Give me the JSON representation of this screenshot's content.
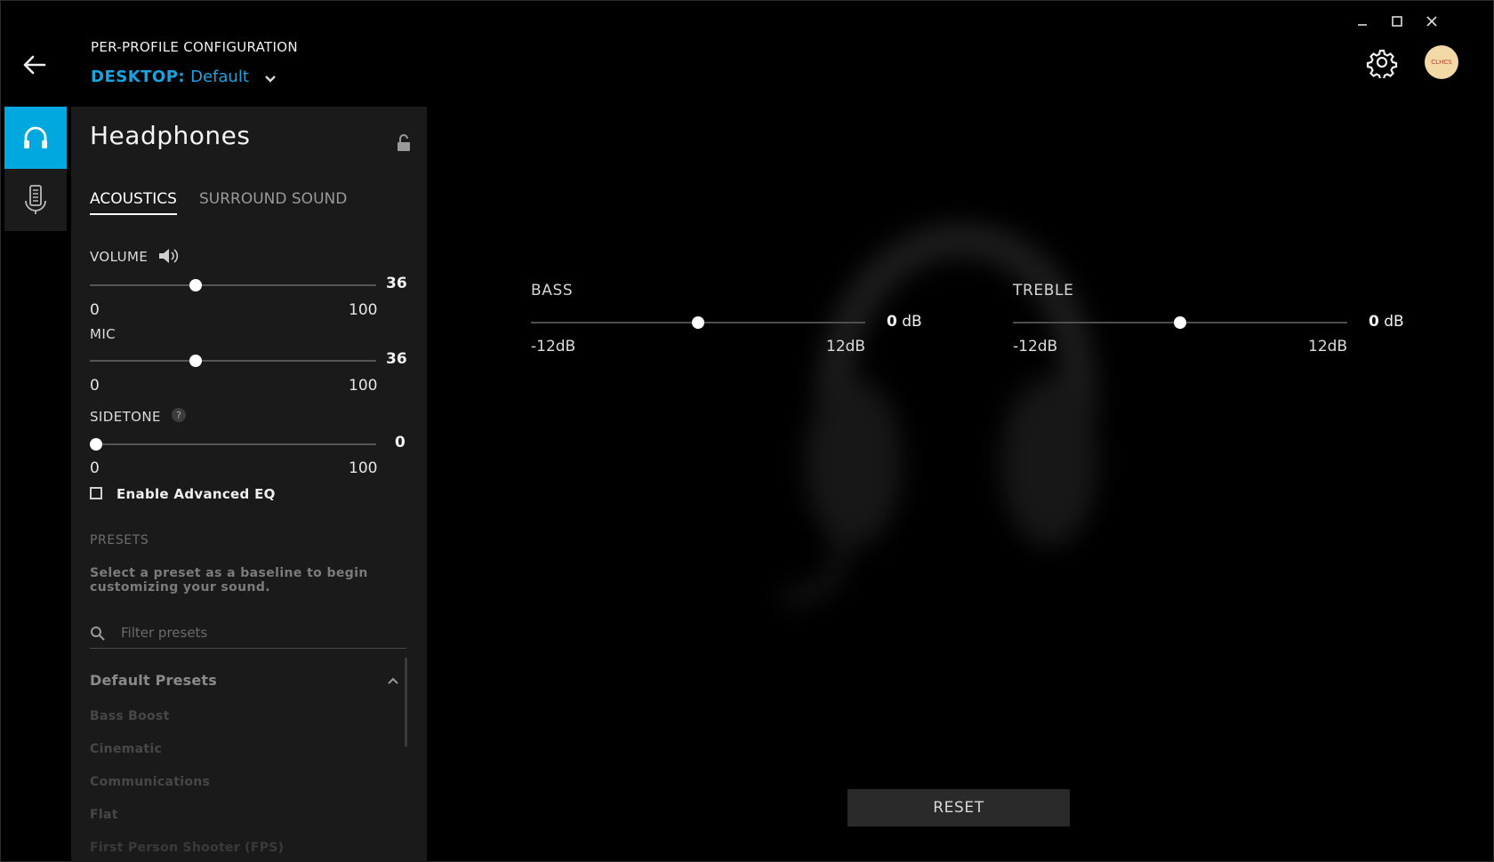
{
  "window": {
    "controls": {
      "minimize": "–",
      "maximize": "☐",
      "close": "✕"
    }
  },
  "header": {
    "config_title": "PER-PROFILE CONFIGURATION",
    "profile_prefix": "DESKTOP:",
    "profile_name": "Default",
    "avatar_text": "CLHCS",
    "icons": [
      "back-arrow-icon",
      "chevron-down-icon",
      "gear-icon"
    ]
  },
  "rail": {
    "items": [
      {
        "icon": "headphones-icon",
        "active": true
      },
      {
        "icon": "microphone-icon",
        "active": false
      }
    ]
  },
  "panel": {
    "title": "Headphones",
    "tabs": [
      {
        "label": "ACOUSTICS",
        "active": true
      },
      {
        "label": "SURROUND SOUND",
        "active": false
      }
    ],
    "volume": {
      "label": "VOLUME",
      "value": "36",
      "min": "0",
      "max": "100"
    },
    "mic": {
      "label": "MIC",
      "value": "36",
      "min": "0",
      "max": "100"
    },
    "sidetone": {
      "label": "SIDETONE",
      "value": "0",
      "min": "0",
      "max": "100",
      "help": "?"
    },
    "advanced_eq": {
      "label": "Enable Advanced EQ",
      "checked": false
    },
    "presets": {
      "heading": "PRESETS",
      "description": "Select a preset as a baseline to begin customizing your sound.",
      "filter_placeholder": "Filter presets",
      "group": "Default Presets",
      "items": [
        "Bass Boost",
        "Cinematic",
        "Communications",
        "Flat",
        "First Person Shooter (FPS)"
      ]
    }
  },
  "eq": {
    "bass": {
      "label": "BASS",
      "value": "0",
      "unit": "dB",
      "min": "-12dB",
      "max": "12dB"
    },
    "treble": {
      "label": "TREBLE",
      "value": "0",
      "unit": "dB",
      "min": "-12dB",
      "max": "12dB"
    }
  },
  "reset_label": "RESET",
  "colors": {
    "accent": "#00a8e0",
    "profile_blue": "#19a4e0",
    "panel_bg": "#1a1a1a"
  }
}
